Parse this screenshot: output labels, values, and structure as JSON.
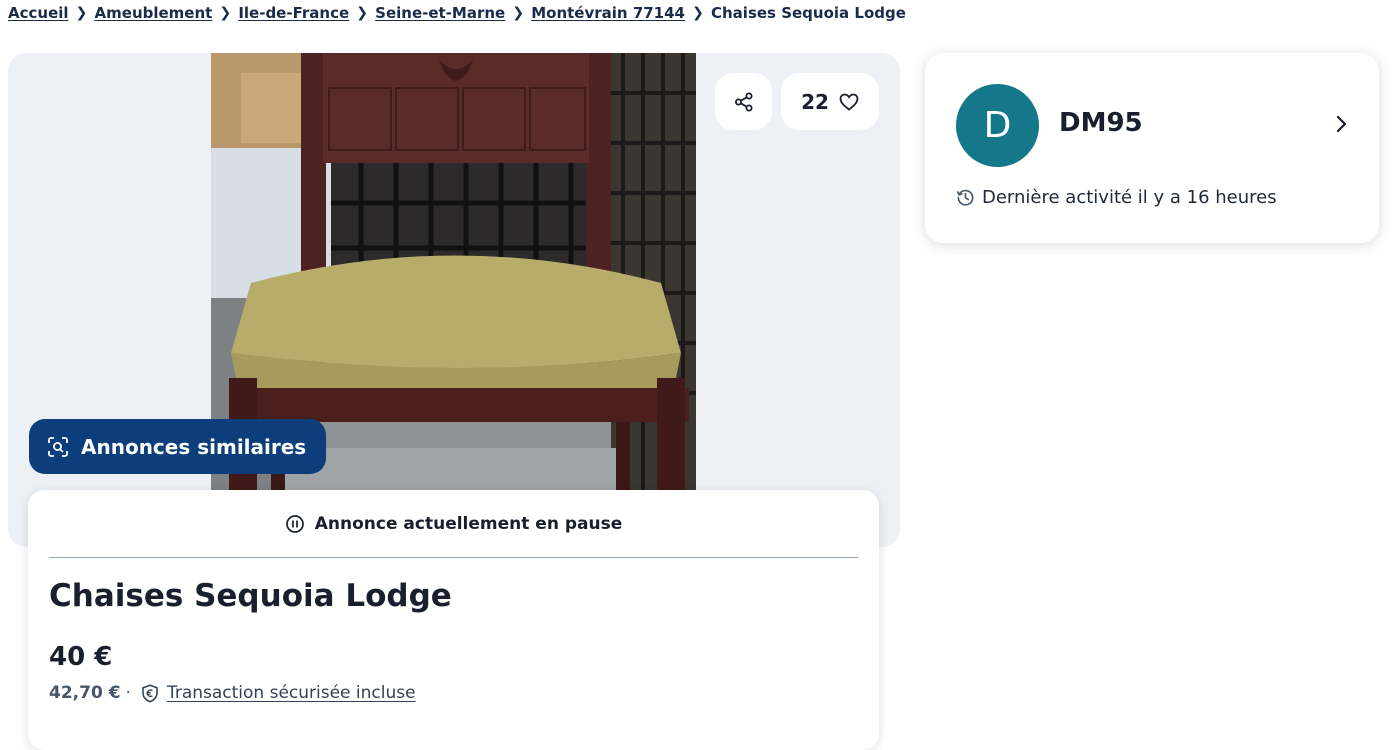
{
  "breadcrumb": {
    "items": [
      "Accueil",
      "Ameublement",
      "Ile-de-France",
      "Seine-et-Marne",
      "Montévrain 77144"
    ],
    "current": "Chaises Sequoia Lodge"
  },
  "gallery": {
    "favorites_count": "22",
    "similar_ads_label": "Annonces similaires",
    "icons": {
      "share": "share-icon",
      "favorite": "heart-icon",
      "similar": "visual-search-icon"
    }
  },
  "listing": {
    "status": "Annonce actuellement en pause",
    "status_icon": "pause-circle-icon",
    "title": "Chaises Sequoia Lodge",
    "price": "40 €",
    "price_total": "42,70 €",
    "secure_icon": "shield-euro-icon",
    "secure_label": "Transaction sécurisée incluse"
  },
  "seller": {
    "avatar_letter": "D",
    "name": "DM95",
    "last_activity": "Dernière activité il y a 16 heures",
    "activity_icon": "history-clock-icon"
  },
  "colors": {
    "brand_dark_blue": "#0b3e7a",
    "avatar_teal": "#15788a",
    "gallery_bg": "#edf1f6"
  }
}
